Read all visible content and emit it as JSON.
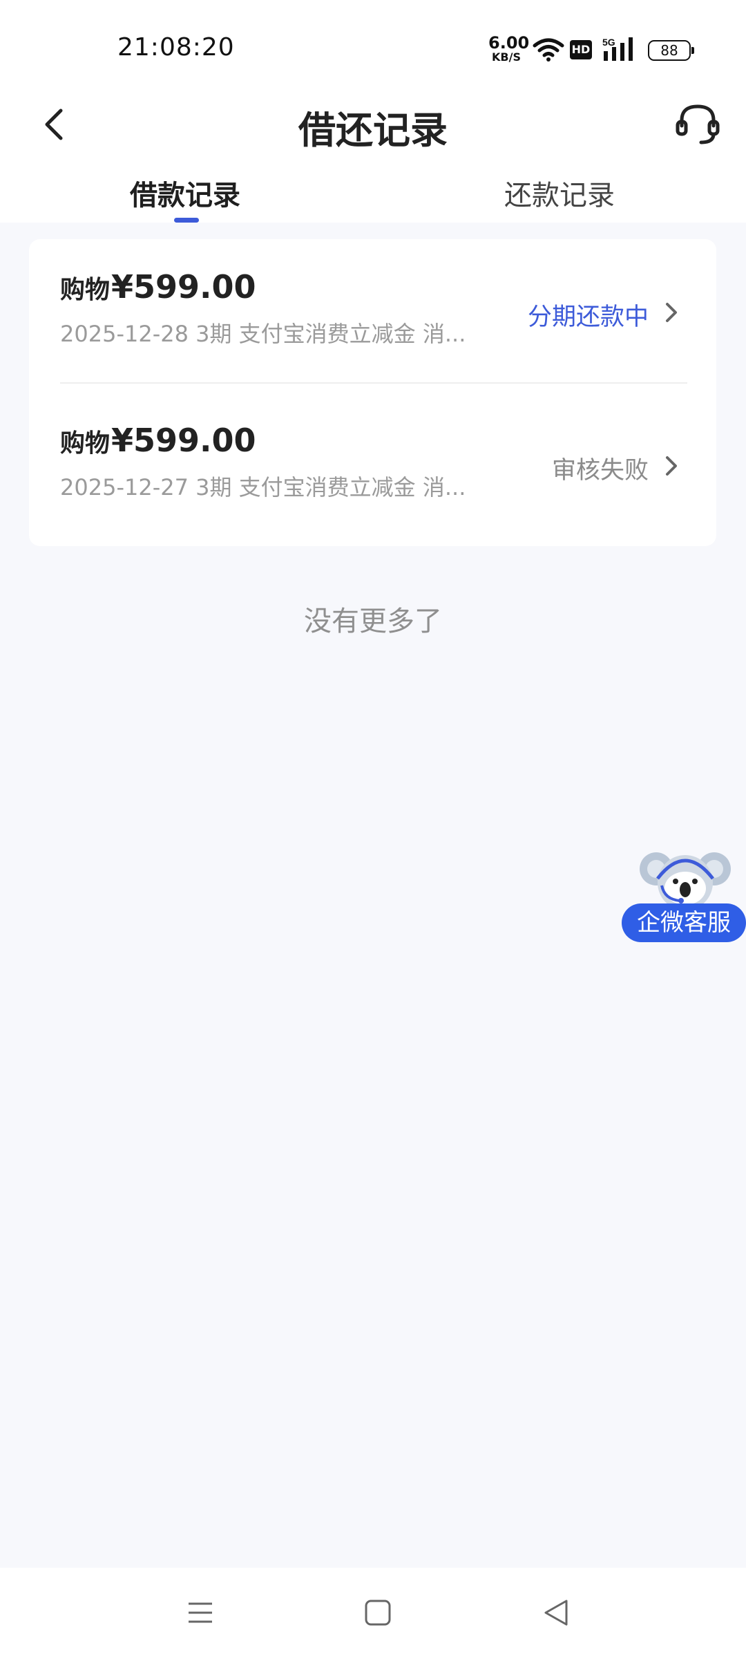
{
  "status_bar": {
    "time": "21:08:20",
    "net_speed_value": "6.00",
    "net_speed_unit": "KB/S",
    "hd_label": "HD",
    "signal_label": "5G",
    "battery": "88"
  },
  "header": {
    "title": "借还记录",
    "back_icon": "chevron-left-icon",
    "service_icon": "headset-icon"
  },
  "tabs": [
    {
      "label": "借款记录",
      "active": true
    },
    {
      "label": "还款记录",
      "active": false
    }
  ],
  "records": [
    {
      "label": "购物",
      "amount": "¥599.00",
      "subtitle": "2025-12-28 3期 支付宝消费立减金 消...",
      "status": "分期还款中"
    },
    {
      "label": "购物",
      "amount": "¥599.00",
      "subtitle": "2025-12-27 3期 支付宝消费立减金 消...",
      "status": "审核失败"
    }
  ],
  "list_end_text": "没有更多了",
  "floating_service": {
    "label": "企微客服",
    "icon": "koala-agent-icon"
  },
  "colors": {
    "accent": "#3d5bd9",
    "background": "#f7f8fc",
    "float_button": "#2f5ee6",
    "status_active": "#3d5bd9",
    "status_failed": "#8b8b8b"
  },
  "navbar": {
    "icons": [
      "menu-icon",
      "home-square-icon",
      "back-triangle-icon"
    ]
  }
}
